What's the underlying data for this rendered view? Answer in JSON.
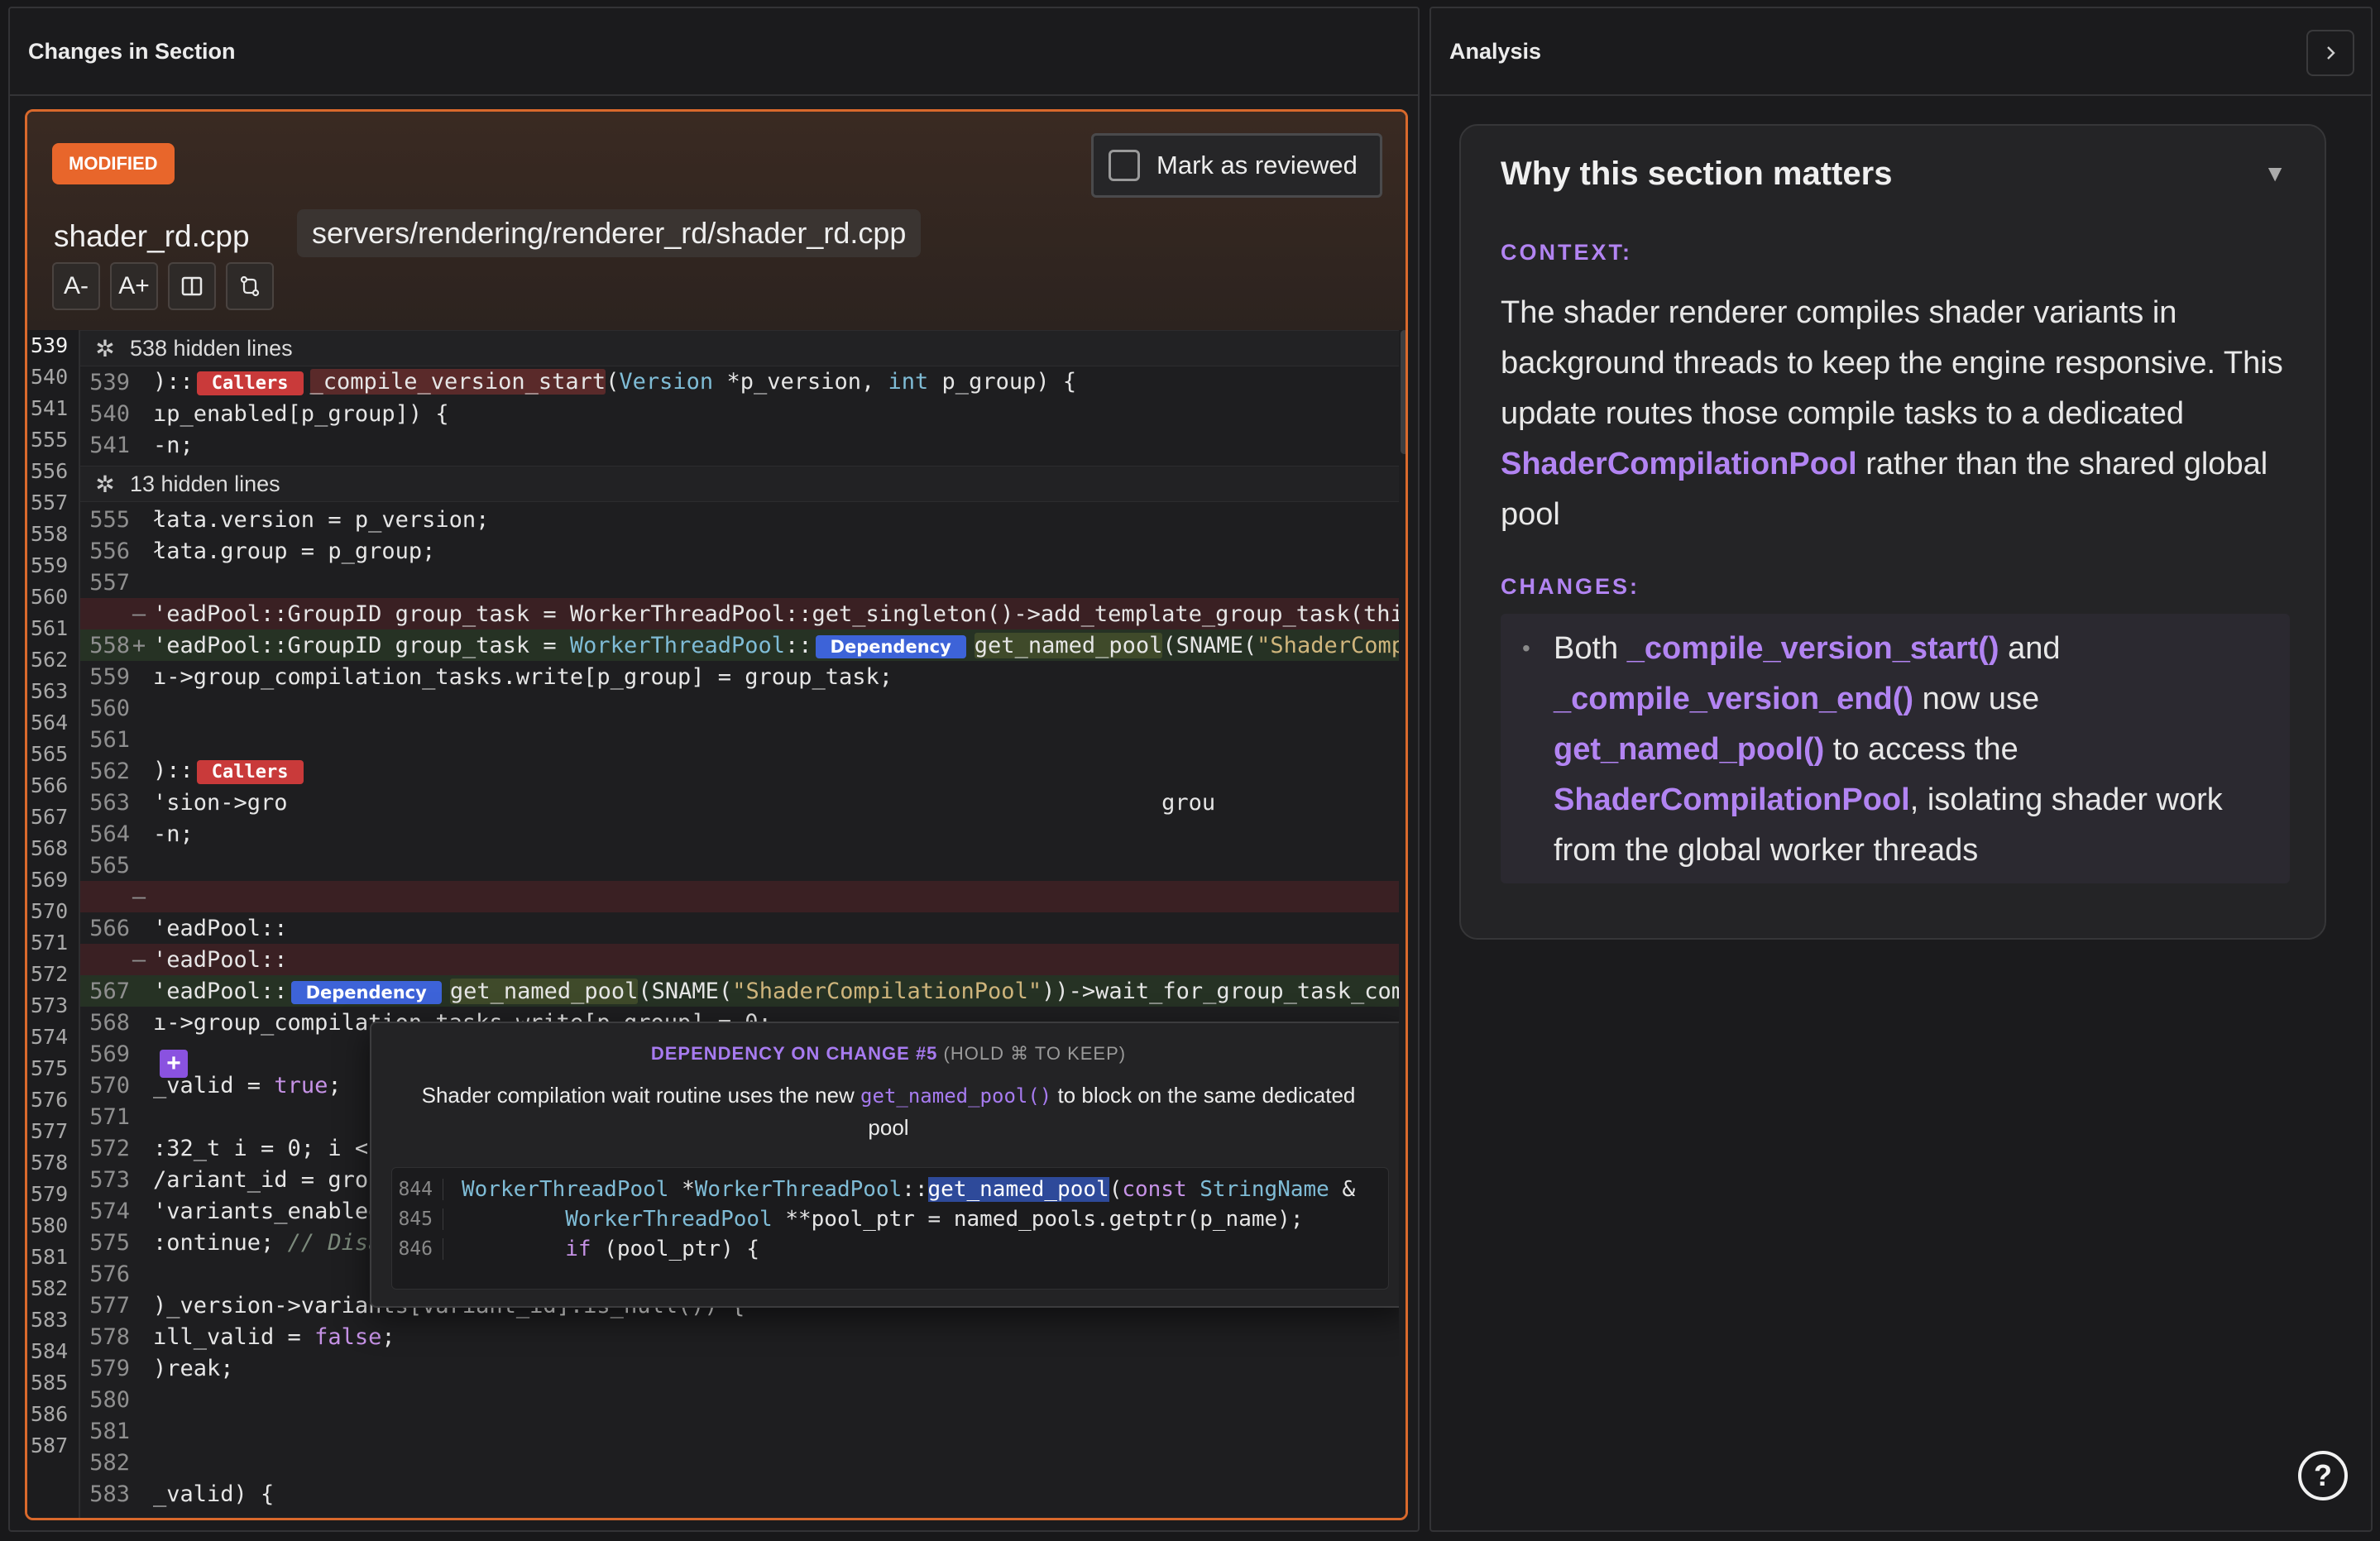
{
  "left_panel": {
    "title": "Changes in Section"
  },
  "right_panel": {
    "title": "Analysis",
    "collapse_icon": "chevron-right-icon"
  },
  "change": {
    "status_badge": "MODIFIED",
    "mark_reviewed_label": "Mark as reviewed",
    "file_name": "shader_rd.cpp",
    "file_path": "servers/rendering/renderer_rd/shader_rd.cpp",
    "toolbar": {
      "font_decrease": "A-",
      "font_increase": "A+",
      "split_view_icon": "split-view-icon",
      "compare_icon": "git-compare-icon"
    }
  },
  "outer_line_numbers": [
    "539",
    "540",
    "541",
    "555",
    "556",
    "557",
    "558",
    "559",
    "560",
    "561",
    "562",
    "563",
    "564",
    "565",
    "566",
    "567",
    "568",
    "569",
    "570",
    "571",
    "572",
    "573",
    "574",
    "575",
    "576",
    "577",
    "578",
    "579",
    "580",
    "581",
    "582",
    "583",
    "584",
    "585",
    "586",
    "587"
  ],
  "code": {
    "hidden_1": "538 hidden lines",
    "hidden_2": "13 hidden lines",
    "callers_label": "Callers",
    "dependency_label": "Dependency",
    "lines": {
      "l539": "539",
      "l540": "540",
      "l541": "541",
      "l555": "555",
      "l556": "556",
      "l557": "557",
      "l558": "558",
      "l559": "559",
      "l560": "560",
      "l561": "561",
      "l562": "562",
      "l563": "563",
      "l564": "564",
      "l565": "565",
      "l566": "566",
      "l567": "567",
      "l568": "568",
      "l569": "569",
      "l570": "570",
      "l571": "571",
      "l572": "572",
      "l573": "573",
      "l574": "574",
      "l575": "575",
      "l576": "576",
      "l577": "577",
      "l578": "578",
      "l579": "579",
      "l580": "580",
      "l581": "581",
      "l582": "582",
      "l583": "583"
    },
    "marker_minus": "—",
    "marker_plus": "+"
  },
  "tooltip": {
    "title": "DEPENDENCY ON CHANGE #5",
    "hint": "(HOLD ⌘ TO KEEP)",
    "desc_before": "Shader compilation wait routine uses the new ",
    "desc_code": "get_named_pool()",
    "desc_after": " to block on the same dedicated pool",
    "snippet": [
      {
        "ln": "844"
      },
      {
        "ln": "845"
      },
      {
        "ln": "846"
      }
    ]
  },
  "analysis": {
    "card_title": "Why this section matters",
    "context_label": "CONTEXT:",
    "context_before": "The shader renderer compiles shader variants in background threads to keep the engine responsive. This update routes those compile tasks to a dedicated ",
    "context_accent": "ShaderCompilationPool",
    "context_after": " rather than the shared global pool",
    "changes_label": "CHANGES:",
    "changes_parts": {
      "p1": "Both ",
      "a1": "_compile_version_start()",
      "p2": " and ",
      "a2": "_compile_version_end()",
      "p3": " now use ",
      "a3": "get_named_pool()",
      "p4": " to access the ",
      "a4": "ShaderCompilationPool",
      "p5": ", isolating shader work from the global worker threads"
    }
  },
  "colors": {
    "accent_orange": "#e8662b",
    "accent_purple": "#b284f2",
    "callers_red": "#c93a3a",
    "dependency_blue": "#3d63d8"
  }
}
